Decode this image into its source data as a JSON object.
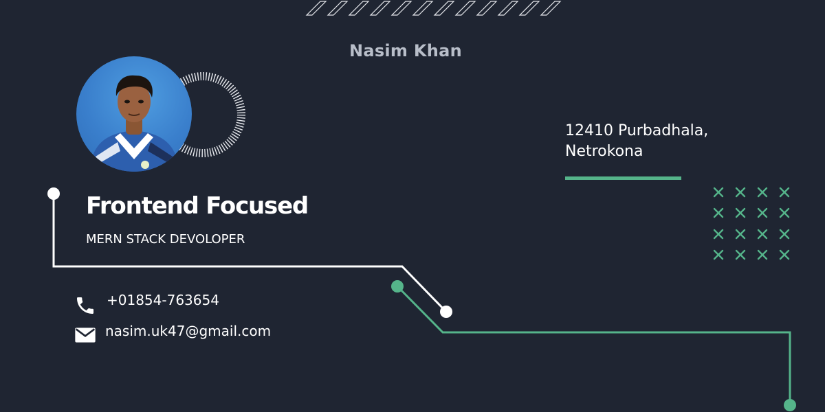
{
  "profile": {
    "name": "Nasim Khan",
    "headline": "Frontend Focused",
    "role": "MERN STACK DEVOLOPER"
  },
  "address": {
    "line1": "12410 Purbadhala,",
    "line2": "Netrokona"
  },
  "contact": {
    "phone": "+01854-763654",
    "email": "nasim.uk47@gmail.com"
  },
  "icons": {
    "phone": "phone-icon",
    "email": "mail-icon",
    "photo": "profile-photo"
  },
  "colors": {
    "background": "#1f2532",
    "accent_green": "#55b48a",
    "name_gray": "#b8bec9",
    "white": "#ffffff"
  }
}
